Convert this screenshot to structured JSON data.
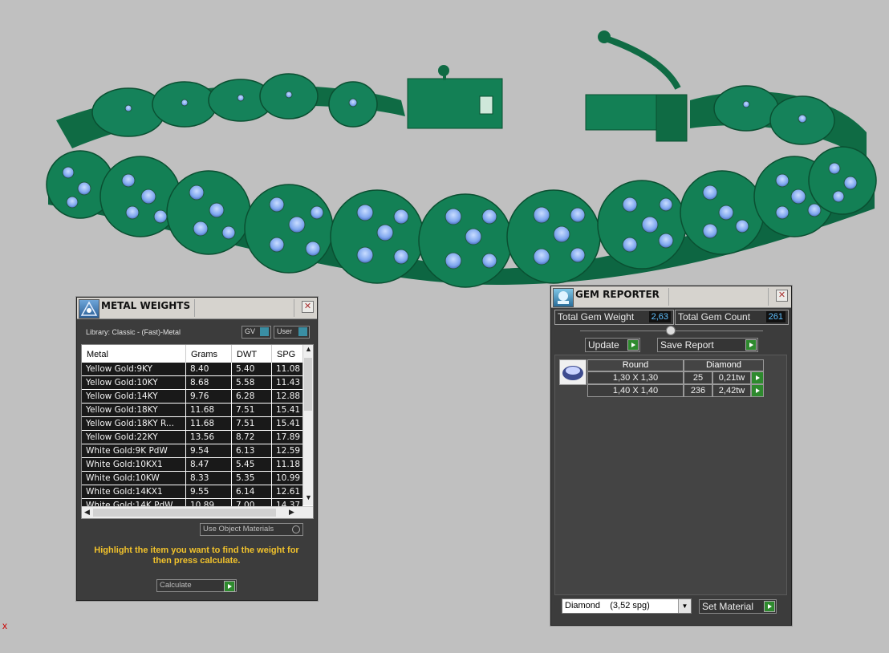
{
  "metal_weights": {
    "title": "METAL WEIGHTS",
    "library": "Library: Classic - (Fast)-Metal",
    "toggle_gv": "GV",
    "toggle_user": "User",
    "columns": [
      "Metal",
      "Grams",
      "DWT",
      "SPG"
    ],
    "rows": [
      [
        "Yellow Gold:9KY",
        "8.40",
        "5.40",
        "11.08"
      ],
      [
        "Yellow Gold:10KY",
        "8.68",
        "5.58",
        "11.43"
      ],
      [
        "Yellow Gold:14KY",
        "9.76",
        "6.28",
        "12.88"
      ],
      [
        "Yellow Gold:18KY",
        "11.68",
        "7.51",
        "15.41"
      ],
      [
        "Yellow Gold:18KY R...",
        "11.68",
        "7.51",
        "15.41"
      ],
      [
        "Yellow Gold:22KY",
        "13.56",
        "8.72",
        "17.89"
      ],
      [
        "White Gold:9K PdW",
        "9.54",
        "6.13",
        "12.59"
      ],
      [
        "White Gold:10KX1",
        "8.47",
        "5.45",
        "11.18"
      ],
      [
        "White Gold:10KW",
        "8.33",
        "5.35",
        "10.99"
      ],
      [
        "White Gold:14KX1",
        "9.55",
        "6.14",
        "12.61"
      ],
      [
        "White Gold:14K PdW",
        "10.89",
        "7.00",
        "14.37"
      ]
    ],
    "use_object_materials": "Use Object Materials",
    "instruction": "Highlight the item you want to find the weight for then press calculate.",
    "calculate_label": "Calculate"
  },
  "gem_reporter": {
    "title": "GEM REPORTER",
    "total_weight_label": "Total Gem Weight",
    "total_weight_value": "2,63",
    "total_count_label": "Total Gem Count",
    "total_count_value": "261",
    "update_label": "Update",
    "save_report_label": "Save Report",
    "table_head": [
      "Round",
      "Diamond"
    ],
    "rows": [
      {
        "size": "1,30 X 1,30",
        "count": "25",
        "weight": "0,21tw"
      },
      {
        "size": "1,40 X 1,40",
        "count": "236",
        "weight": "2,42tw"
      }
    ],
    "material_select": "Diamond    (3,52 spg)",
    "set_material_label": "Set Material"
  },
  "corner_mark": "x",
  "colors": {
    "metal_green": "#11734a",
    "gem_blue": "#8fb6f2",
    "panel_bg": "#3c3c3c",
    "instruction_text": "#f1c22c",
    "viewport_bg": "#c0c0c0"
  }
}
